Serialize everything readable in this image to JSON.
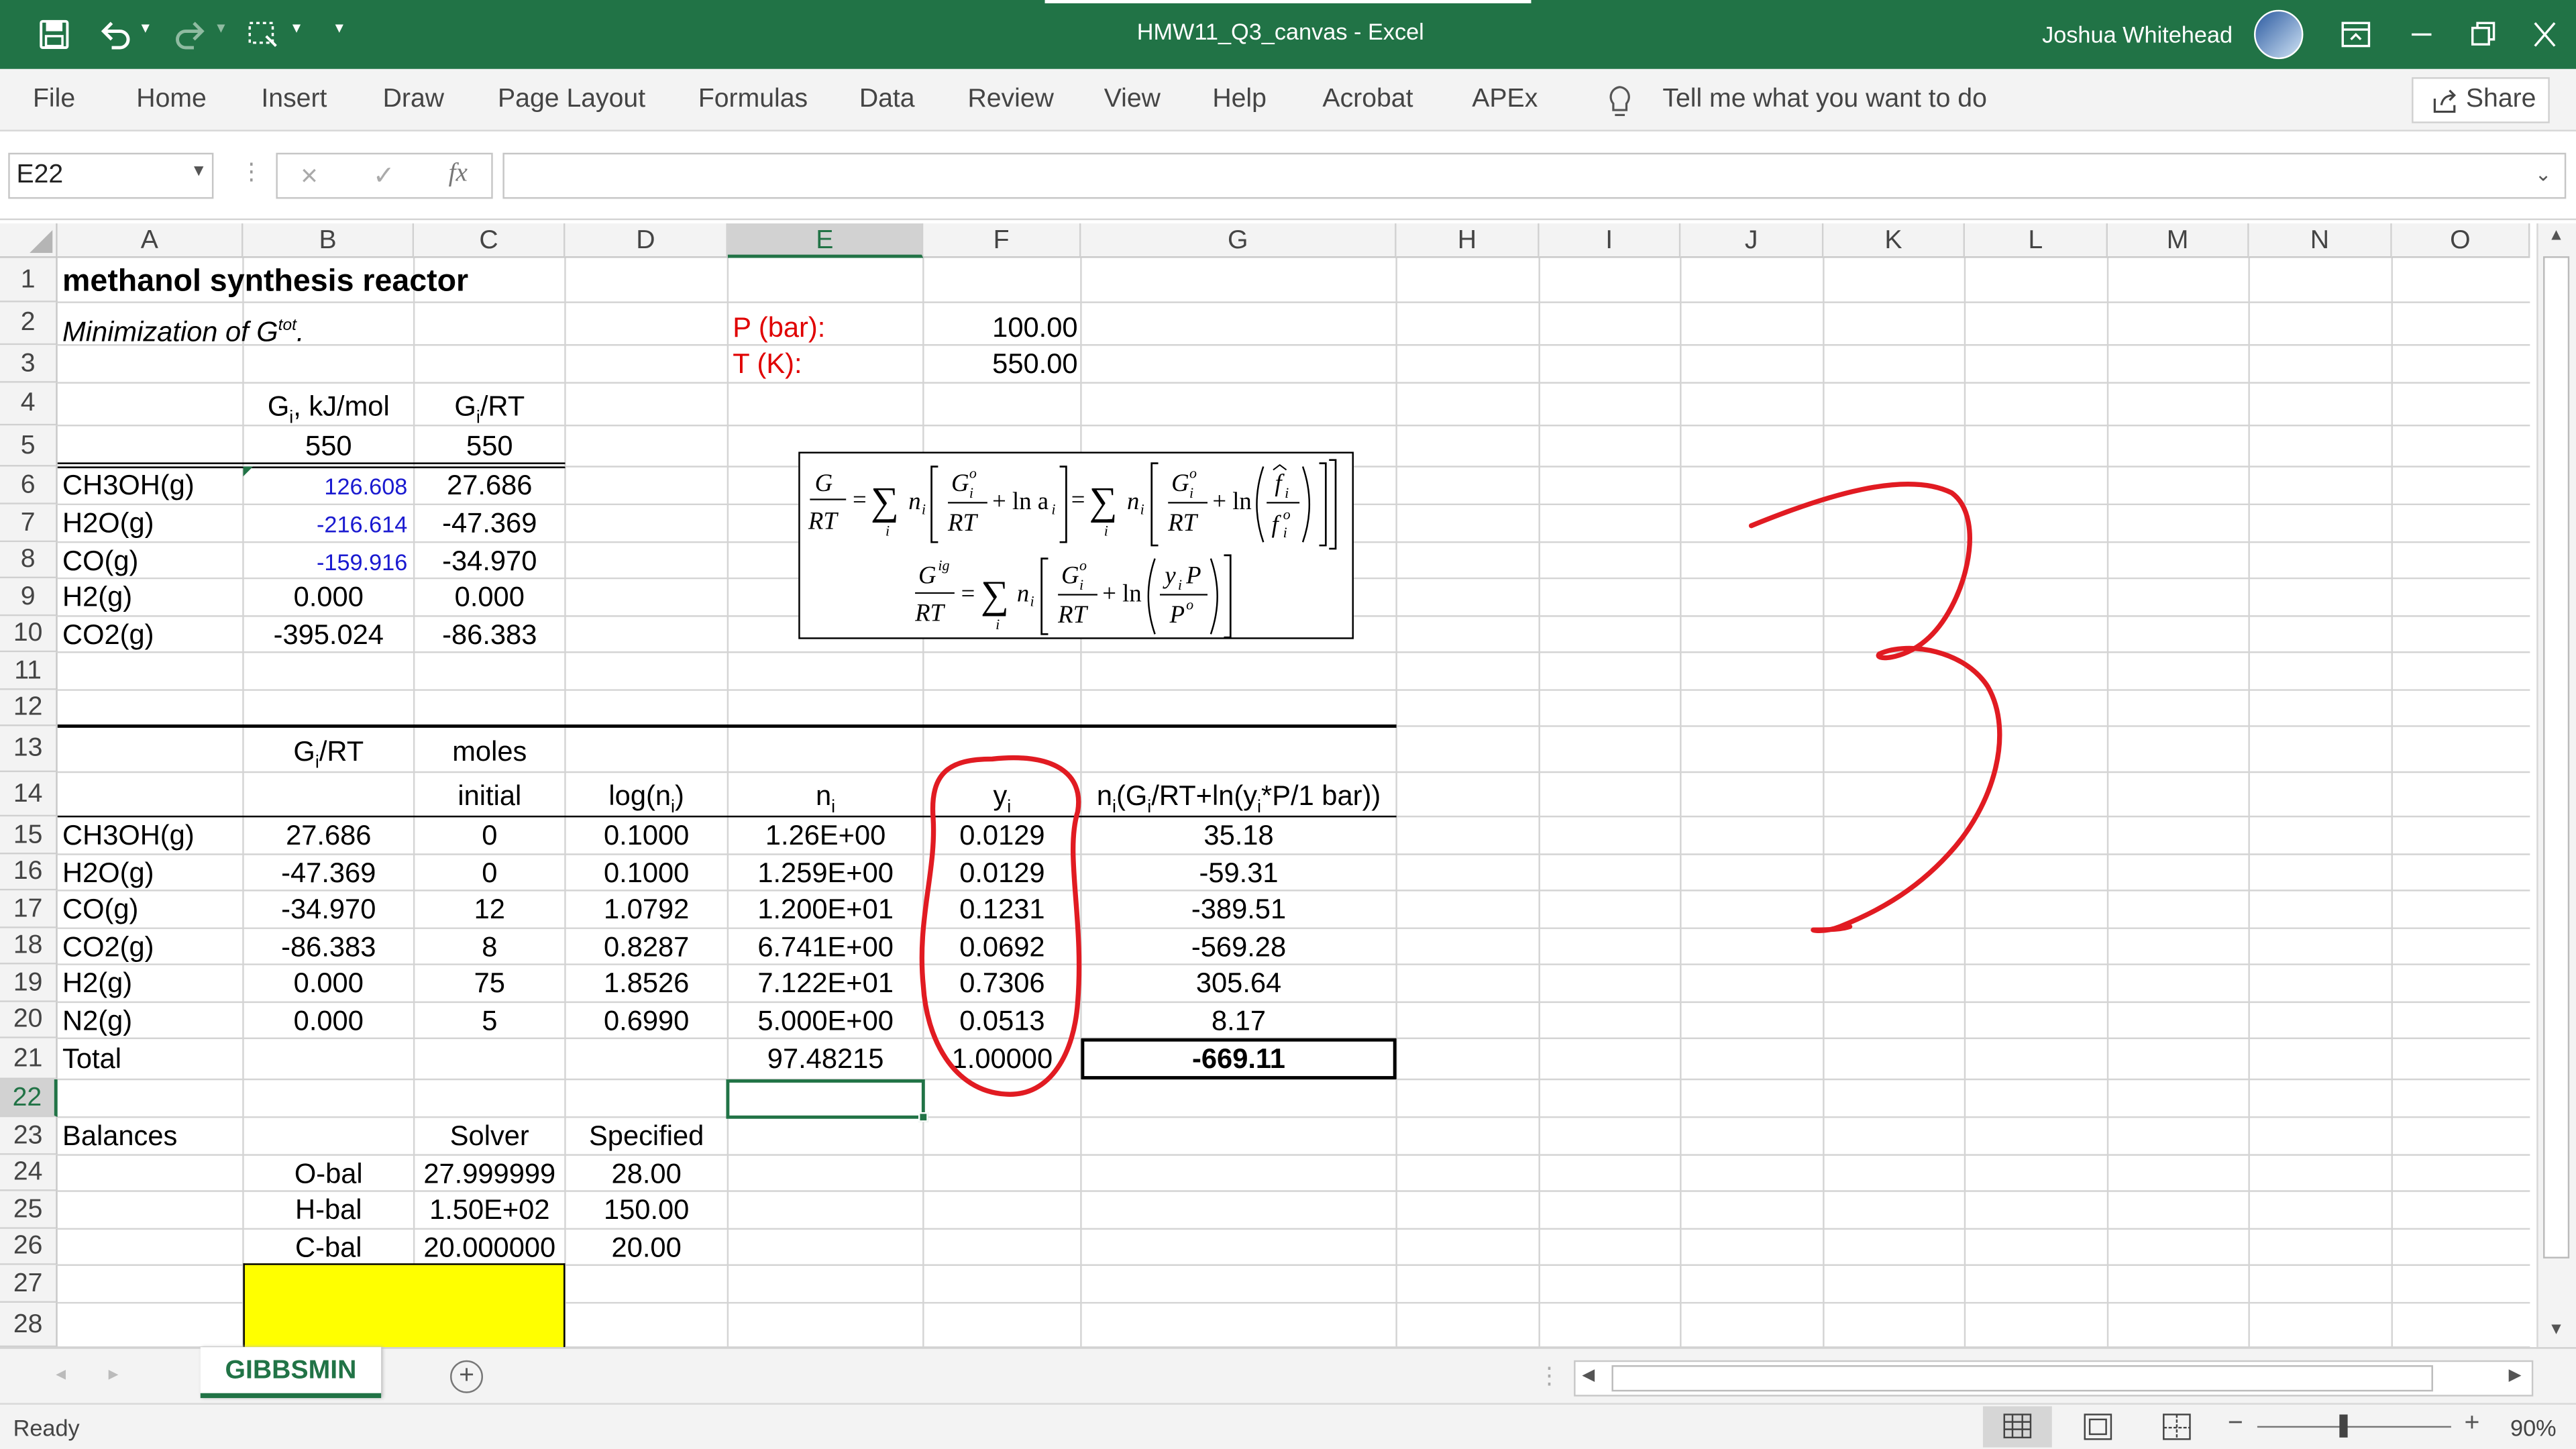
{
  "title_bar": {
    "document_title": "HMW11_Q3_canvas  -  Excel",
    "user_name": "Joshua Whitehead"
  },
  "ribbon": {
    "tabs": [
      "File",
      "Home",
      "Insert",
      "Draw",
      "Page Layout",
      "Formulas",
      "Data",
      "Review",
      "View",
      "Help",
      "Acrobat",
      "APEx"
    ],
    "tell_me": "Tell me what you want to do",
    "share": "Share"
  },
  "formula_bar": {
    "name_box": "E22",
    "cancel": "×",
    "enter": "✓",
    "fx": "fx",
    "formula": ""
  },
  "columns": [
    "A",
    "B",
    "C",
    "D",
    "E",
    "F",
    "G",
    "H",
    "I",
    "J",
    "K",
    "L",
    "M",
    "N",
    "O"
  ],
  "rows": [
    "1",
    "2",
    "3",
    "4",
    "5",
    "6",
    "7",
    "8",
    "9",
    "10",
    "11",
    "12",
    "13",
    "14",
    "15",
    "16",
    "17",
    "18",
    "19",
    "20",
    "21",
    "22",
    "23",
    "24",
    "25",
    "26",
    "27",
    "28"
  ],
  "sheet": {
    "title": "methanol synthesis reactor",
    "subtitle": "Minimization of G",
    "subtitle_sup": "tot",
    "subtitle_end": ".",
    "p_label": "P (bar):",
    "p_value": "100.00",
    "t_label": "T (K):",
    "t_value": "550.00",
    "hdr_gi_main": "G",
    "hdr_gi_sub": "i",
    "hdr_gi_rest": ", kJ/mol",
    "hdr_girt_main": "G",
    "hdr_girt_sub": "i",
    "hdr_girt_rest": "/RT",
    "temp_b5": "550",
    "temp_c5": "550",
    "species_top": [
      {
        "name": "CH3OH(g)",
        "g": "126.608",
        "grt": "27.686"
      },
      {
        "name": "H2O(g)",
        "g": "-216.614",
        "grt": "-47.369"
      },
      {
        "name": "CO(g)",
        "g": "-159.916",
        "grt": "-34.970"
      },
      {
        "name": "H2(g)",
        "g": "0.000",
        "grt": "0.000"
      },
      {
        "name": "CO2(g)",
        "g": "-395.024",
        "grt": "-86.383"
      }
    ],
    "h13_b_main": "G",
    "h13_b_sub": "i",
    "h13_b_rest": "/RT",
    "h13_c": "moles",
    "h14_c": "initial",
    "h14_d_main": "log(n",
    "h14_d_sub": "i",
    "h14_d_rest": ")",
    "h14_e_main": "n",
    "h14_e_sub": "i",
    "h14_f_main": "y",
    "h14_f_sub": "i",
    "h14_g_1": "n",
    "h14_g_2": "i",
    "h14_g_3": "(G",
    "h14_g_4": "i",
    "h14_g_5": "/RT+ln(y",
    "h14_g_6": "i",
    "h14_g_7": "*P/1 bar))",
    "species_bottom": [
      {
        "name": "CH3OH(g)",
        "grt": "27.686",
        "init": "0",
        "logn": "0.1000",
        "n": "1.26E+00",
        "y": "0.0129",
        "term": "35.18"
      },
      {
        "name": "H2O(g)",
        "grt": "-47.369",
        "init": "0",
        "logn": "0.1000",
        "n": "1.259E+00",
        "y": "0.0129",
        "term": "-59.31"
      },
      {
        "name": "CO(g)",
        "grt": "-34.970",
        "init": "12",
        "logn": "1.0792",
        "n": "1.200E+01",
        "y": "0.1231",
        "term": "-389.51"
      },
      {
        "name": "CO2(g)",
        "grt": "-86.383",
        "init": "8",
        "logn": "0.8287",
        "n": "6.741E+00",
        "y": "0.0692",
        "term": "-569.28"
      },
      {
        "name": "H2(g)",
        "grt": "0.000",
        "init": "75",
        "logn": "1.8526",
        "n": "7.122E+01",
        "y": "0.7306",
        "term": "305.64"
      },
      {
        "name": "N2(g)",
        "grt": "0.000",
        "init": "5",
        "logn": "0.6990",
        "n": "5.000E+00",
        "y": "0.0513",
        "term": "8.17"
      }
    ],
    "total_label": "Total",
    "total_n": "97.48215",
    "total_y": "1.00000",
    "total_term": "-669.11",
    "balances_label": "Balances",
    "solver_label": "Solver",
    "specified_label": "Specified",
    "balances": [
      {
        "name": "O-bal",
        "solver": "27.999999",
        "spec": "28.00"
      },
      {
        "name": "H-bal",
        "solver": "1.50E+02",
        "spec": "150.00"
      },
      {
        "name": "C-bal",
        "solver": "20.000000",
        "spec": "20.00"
      }
    ]
  },
  "equation": {
    "G": "G",
    "RT": "RT",
    "eq": "=",
    "sum": "∑",
    "ni": "n",
    "ni_sub": "i",
    "sum_sub": "i",
    "Gi": "G",
    "Gi_sub": "i",
    "Gi_sup": "o",
    "plus_ln_a": "+ ln a",
    "a_sub": "i",
    "plus_ln": "+ ln",
    "fhat": "f",
    "fhat_sub": "i",
    "fo": "f",
    "fo_sub": "i",
    "fo_sup": "o",
    "Gig": "G",
    "Gig_sup": "ig",
    "yiP": "y",
    "yiP_sub": "i",
    "yiP_P": "P",
    "Po": "P",
    "Po_sup": "o"
  },
  "annotation": {
    "digit": "3",
    "color": "#e11b22"
  },
  "sheet_tabs": {
    "active": "GIBBSMIN",
    "add": "+"
  },
  "status_bar": {
    "ready": "Ready",
    "zoom": "90%",
    "zoom_level_pct": 90
  }
}
